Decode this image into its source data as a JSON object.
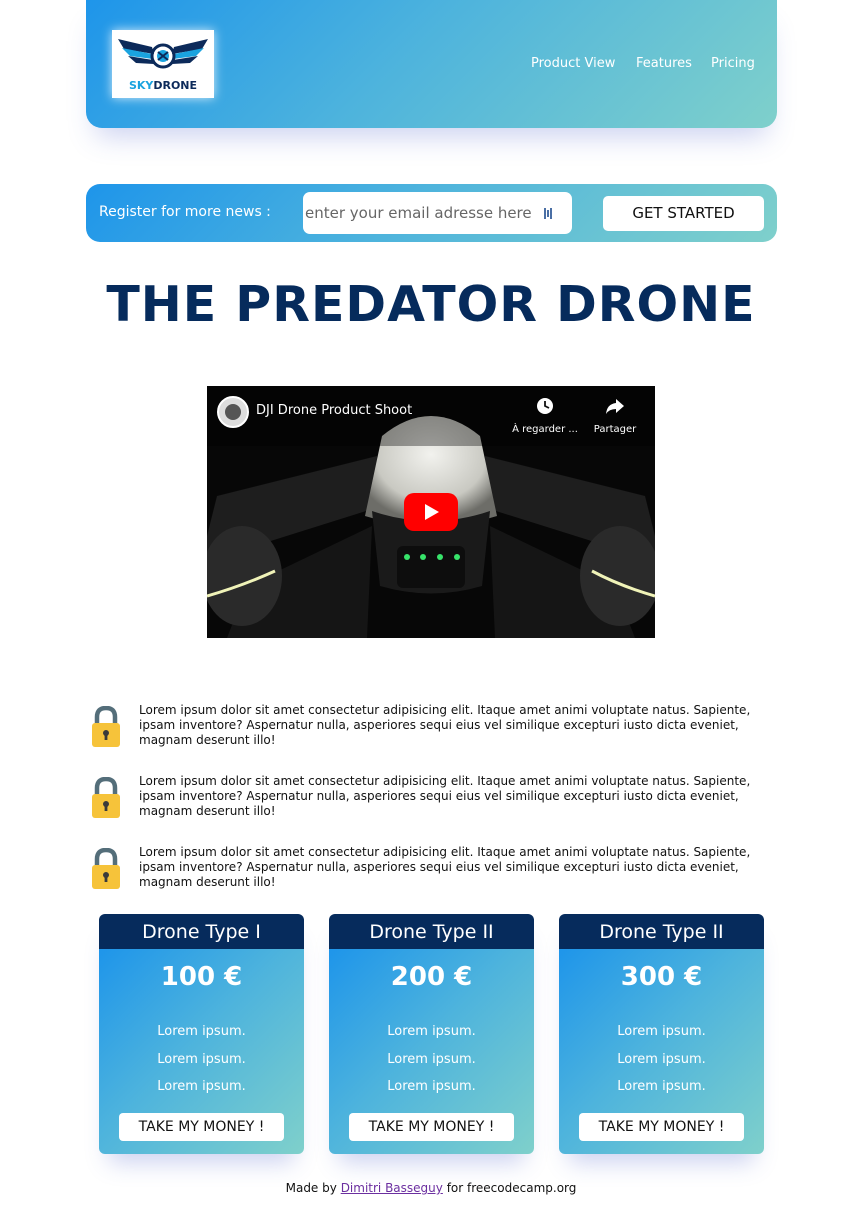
{
  "header": {
    "logo": {
      "part1": "SKY",
      "part2": "DRONE"
    },
    "nav": [
      {
        "label": "Product View"
      },
      {
        "label": "Features"
      },
      {
        "label": "Pricing"
      }
    ]
  },
  "register": {
    "label": "Register for more news :",
    "email_placeholder": "enter your email adresse here",
    "button": "GET STARTED"
  },
  "title": "THE PREDATOR DRONE",
  "video": {
    "title": "DJI Drone Product Shoot",
    "watch_later": "À regarder ...",
    "share": "Partager"
  },
  "features": [
    {
      "text": "Lorem ipsum dolor sit amet consectetur adipisicing elit. Itaque amet animi voluptate natus. Sapiente, ipsam inventore? Aspernatur nulla, asperiores sequi eius vel similique excepturi iusto dicta eveniet, magnam deserunt illo!",
      "icon": "lock-icon"
    },
    {
      "text": "Lorem ipsum dolor sit amet consectetur adipisicing elit. Itaque amet animi voluptate natus. Sapiente, ipsam inventore? Aspernatur nulla, asperiores sequi eius vel similique excepturi iusto dicta eveniet, magnam deserunt illo!",
      "icon": "lock-icon"
    },
    {
      "text": "Lorem ipsum dolor sit amet consectetur adipisicing elit. Itaque amet animi voluptate natus. Sapiente, ipsam inventore? Aspernatur nulla, asperiores sequi eius vel similique excepturi iusto dicta eveniet, magnam deserunt illo!",
      "icon": "lock-icon"
    }
  ],
  "pricing": [
    {
      "name": "Drone Type I",
      "price": "100 €",
      "items": [
        "Lorem ipsum.",
        "Lorem ipsum.",
        "Lorem ipsum."
      ],
      "button": "TAKE MY MONEY !"
    },
    {
      "name": "Drone Type II",
      "price": "200 €",
      "items": [
        "Lorem ipsum.",
        "Lorem ipsum.",
        "Lorem ipsum."
      ],
      "button": "TAKE MY MONEY !"
    },
    {
      "name": "Drone Type II",
      "price": "300 €",
      "items": [
        "Lorem ipsum.",
        "Lorem ipsum.",
        "Lorem ipsum."
      ],
      "button": "TAKE MY MONEY !"
    }
  ],
  "footer": {
    "prefix": "Made by",
    "author": "Dimitri Basseguy",
    "suffix": "for freecodecamp.org"
  },
  "colors": {
    "navy": "#062b5c",
    "gradient_start": "#1e95ea",
    "gradient_end": "#7fd0cb",
    "lock_yellow": "#f4c430"
  }
}
